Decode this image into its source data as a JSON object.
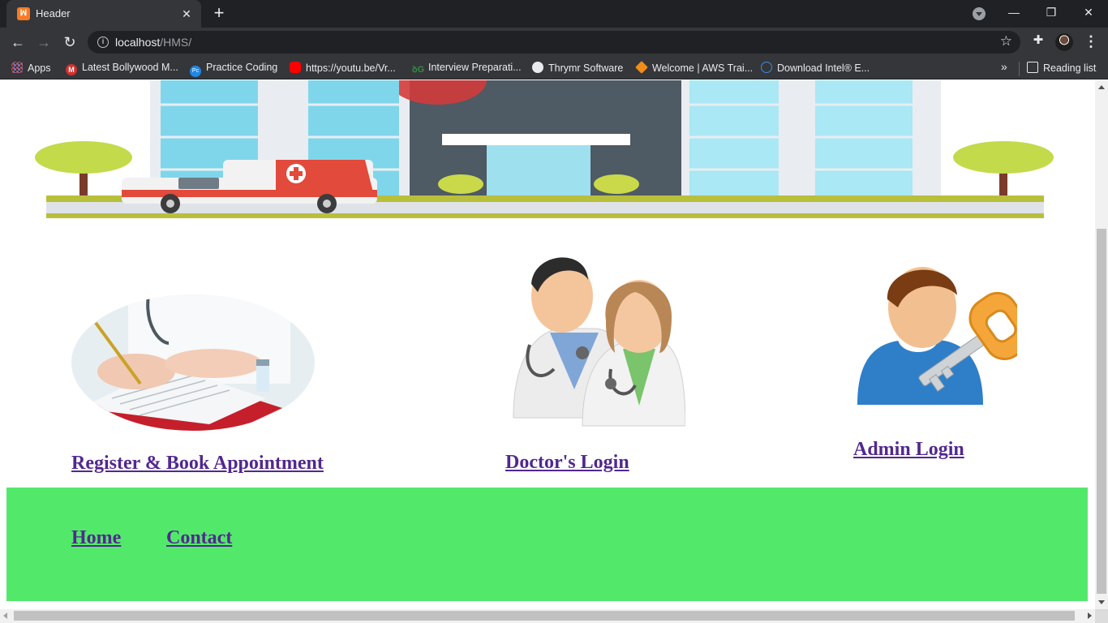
{
  "browser": {
    "tab": {
      "title": "Header",
      "favicon": "xampp-icon",
      "close": "✕"
    },
    "new_tab": "+",
    "window_controls": {
      "minimize": "—",
      "restore": "❐",
      "close": "✕"
    },
    "url": {
      "host": "localhost",
      "path": "/HMS/"
    },
    "nav": {
      "back": "←",
      "forward": "→",
      "reload": "↻"
    },
    "bookmarks": [
      {
        "label": "Apps",
        "icon": "apps-grid-icon"
      },
      {
        "label": "Latest Bollywood M...",
        "icon": "m-icon"
      },
      {
        "label": "Practice Coding",
        "icon": "pc-icon"
      },
      {
        "label": "https://youtu.be/Vr...",
        "icon": "youtube-icon"
      },
      {
        "label": "Interview Preparati...",
        "icon": "gfg-icon"
      },
      {
        "label": "Thrymr Software",
        "icon": "globe-icon"
      },
      {
        "label": "Welcome | AWS Trai...",
        "icon": "aws-icon"
      },
      {
        "label": "Download Intel® E...",
        "icon": "intel-icon"
      }
    ],
    "more_bookmarks": "»",
    "reading_list": "Reading list"
  },
  "page": {
    "cards": [
      {
        "link": "Register & Book Appointment",
        "image": "doctor-writing-image"
      },
      {
        "link": "Doctor's Login",
        "image": "doctors-image"
      },
      {
        "link": "Admin Login",
        "image": "admin-key-image"
      }
    ],
    "footer": {
      "links": [
        "Home",
        "Contact"
      ],
      "background": "#52e96b"
    },
    "link_color": "#52288f"
  }
}
